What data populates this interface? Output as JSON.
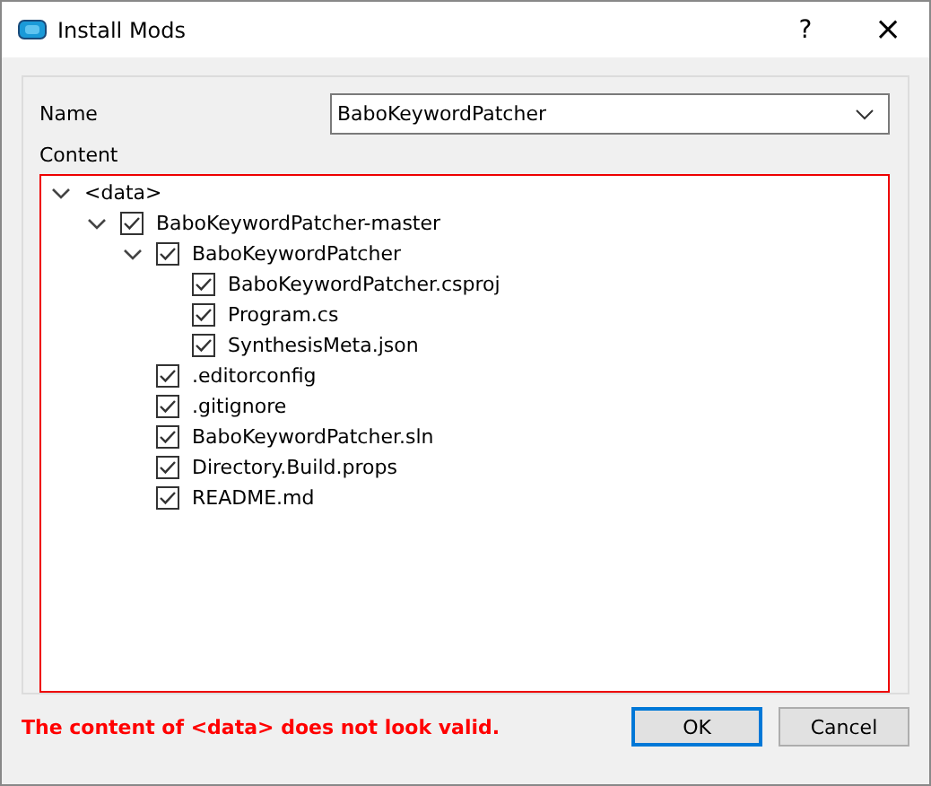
{
  "window": {
    "title": "Install Mods",
    "help": "?",
    "close": "×"
  },
  "name_field": {
    "label": "Name",
    "value": "BaboKeywordPatcher"
  },
  "content": {
    "label": "Content",
    "tree": [
      {
        "label": "<data>",
        "expanded": true,
        "children": [
          {
            "label": "BaboKeywordPatcher-master",
            "checked": true,
            "expanded": true,
            "children": [
              {
                "label": "BaboKeywordPatcher",
                "checked": true,
                "expanded": true,
                "children": [
                  {
                    "label": "BaboKeywordPatcher.csproj",
                    "checked": true
                  },
                  {
                    "label": "Program.cs",
                    "checked": true
                  },
                  {
                    "label": "SynthesisMeta.json",
                    "checked": true
                  }
                ]
              },
              {
                "label": ".editorconfig",
                "checked": true
              },
              {
                "label": ".gitignore",
                "checked": true
              },
              {
                "label": "BaboKeywordPatcher.sln",
                "checked": true
              },
              {
                "label": "Directory.Build.props",
                "checked": true
              },
              {
                "label": "README.md",
                "checked": true
              }
            ]
          }
        ]
      }
    ]
  },
  "error": "The content of <data> does not look valid.",
  "buttons": [
    {
      "label": "OK",
      "default": true
    },
    {
      "label": "Cancel",
      "default": false
    }
  ]
}
